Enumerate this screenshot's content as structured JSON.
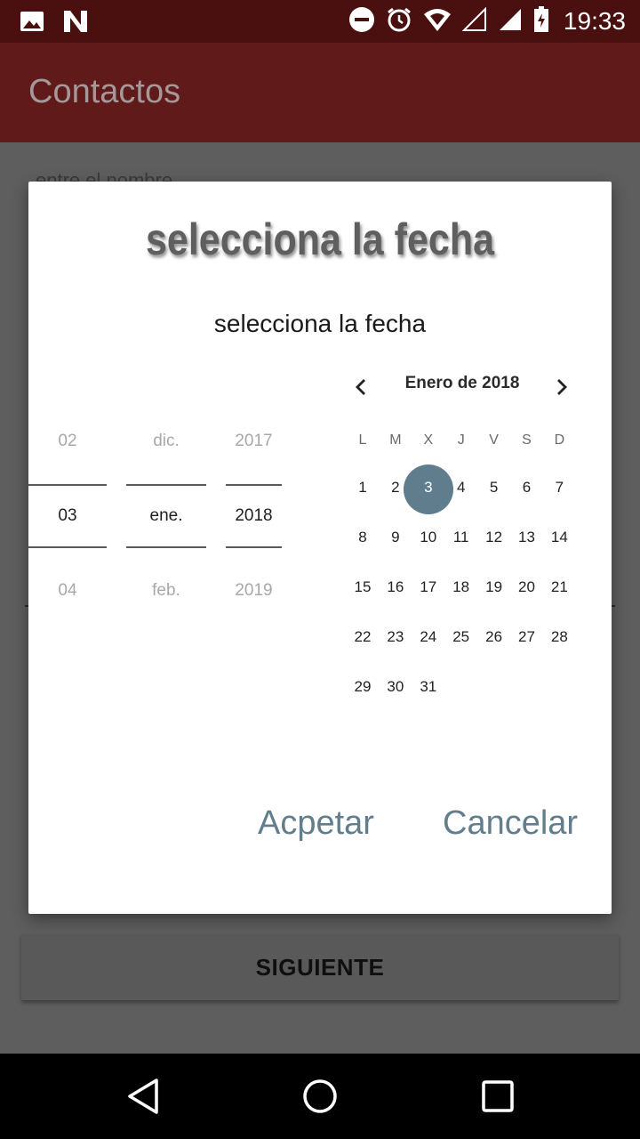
{
  "status_bar": {
    "time": "19:33",
    "icons": [
      "image-icon",
      "n-app-icon",
      "do-not-disturb-icon",
      "alarm-icon",
      "wifi-icon",
      "signal-empty-icon",
      "signal-full-icon",
      "battery-charging-icon"
    ]
  },
  "app_bar": {
    "title": "Contactos"
  },
  "background": {
    "hint_text": "entre el nombre",
    "next_button_label": "SIGUIENTE"
  },
  "dialog": {
    "title": "selecciona la fecha",
    "subtitle": "selecciona la fecha",
    "spinner": {
      "day": {
        "prev": "02",
        "current": "03",
        "next": "04"
      },
      "month": {
        "prev": "dic.",
        "current": "ene.",
        "next": "feb."
      },
      "year": {
        "prev": "2017",
        "current": "2018",
        "next": "2019"
      }
    },
    "calendar": {
      "month_label": "Enero de 2018",
      "weekdays": [
        "L",
        "M",
        "X",
        "J",
        "V",
        "S",
        "D"
      ],
      "weeks": [
        [
          "1",
          "2",
          "3",
          "4",
          "5",
          "6",
          "7"
        ],
        [
          "8",
          "9",
          "10",
          "11",
          "12",
          "13",
          "14"
        ],
        [
          "15",
          "16",
          "17",
          "18",
          "19",
          "20",
          "21"
        ],
        [
          "22",
          "23",
          "24",
          "25",
          "26",
          "27",
          "28"
        ],
        [
          "29",
          "30",
          "31",
          "",
          "",
          "",
          ""
        ]
      ],
      "selected_day": "3",
      "selected_color": "#5f7d8c"
    },
    "buttons": {
      "accept": "Acpetar",
      "cancel": "Cancelar"
    }
  },
  "colors": {
    "status_bar": "#4a1010",
    "app_bar": "#601a1a",
    "accent": "#627e8c"
  }
}
